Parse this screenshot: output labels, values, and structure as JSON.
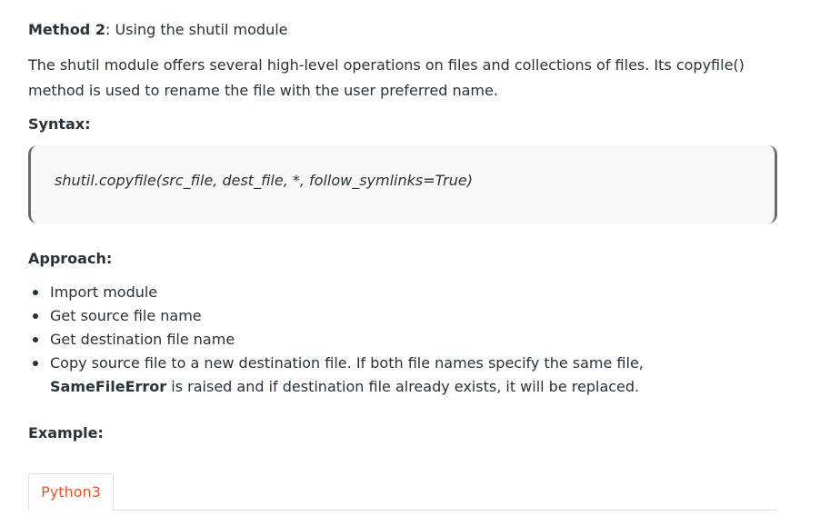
{
  "method_heading": {
    "bold": "Method 2",
    "rest": ": Using the shutil module"
  },
  "intro_paragraph": "The shutil module offers several high-level operations on files and collections of files. Its copyfile() method is used to rename the file with the user preferred name.",
  "syntax": {
    "label": "Syntax:",
    "code": "shutil.copyfile(src_file, dest_file, *, follow_symlinks=True)"
  },
  "approach": {
    "label": "Approach:",
    "items": [
      "Import module",
      "Get source file name",
      "Get destination file name"
    ],
    "last_item": {
      "before": "Copy source file to a new destination file. If both file names specify the same file,",
      "bold": "SameFileError",
      "after": "is raised and if destination file already exists, it will be replaced."
    }
  },
  "example": {
    "label": "Example:",
    "tab_label": "Python3"
  },
  "colors": {
    "text": "#273239",
    "code_bg": "#f8f8f8",
    "code_border": "#6b6b6b",
    "tab_accent": "#e4572e"
  }
}
